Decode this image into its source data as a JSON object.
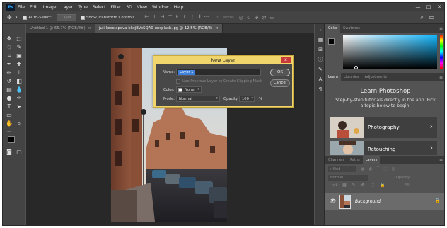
{
  "app": {
    "logo": "Ps"
  },
  "menu": [
    "File",
    "Edit",
    "Image",
    "Layer",
    "Type",
    "Select",
    "Filter",
    "3D",
    "View",
    "Window",
    "Help"
  ],
  "window_controls": {
    "minimize": "—",
    "maximize": "□",
    "close": "✕"
  },
  "options_bar": {
    "auto_select_label": "Auto-Select:",
    "auto_select_target": "Layer",
    "transform_controls_label": "Show Transform Controls",
    "mode_label": "3D Mode:"
  },
  "tabs": [
    {
      "label": "Untitled-1 @ 66.7% (RGB/8#)",
      "close": "×"
    },
    {
      "label": "juli-kosolapova-bkcjBVeSQA0-unsplash.jpg @ 12.5% (RGB/8)",
      "close": "×"
    }
  ],
  "dialog": {
    "title": "New Layer",
    "name_label": "Name:",
    "name_value": "Layer 1",
    "clipping_mask_label": "Use Previous Layer to Create Clipping Mask",
    "color_label": "Color:",
    "color_value": "None",
    "mode_label": "Mode:",
    "mode_value": "Normal",
    "opacity_label": "Opacity:",
    "opacity_value": "100",
    "opacity_unit": "%",
    "ok_label": "OK",
    "cancel_label": "Cancel",
    "close_glyph": "x"
  },
  "color_panel": {
    "tabs": [
      "Color",
      "Swatches"
    ]
  },
  "learn_panel": {
    "tabs": [
      "Learn",
      "Libraries",
      "Adjustments"
    ],
    "title": "Learn Photoshop",
    "subtitle": "Step-by-step tutorials directly in the app. Pick a topic below to begin.",
    "topics": [
      {
        "label": "Photography",
        "arrow": "›"
      },
      {
        "label": "Retouching",
        "arrow": "›"
      }
    ]
  },
  "layers_panel": {
    "tabs": [
      "Channels",
      "Paths",
      "Layers"
    ],
    "kind_placeholder": "Kind",
    "blend_mode": "Normal",
    "opacity_label": "Opacity:",
    "lock_label": "Lock:",
    "fill_label": "Fill:",
    "layer_name": "Background"
  },
  "colors": {
    "accent": "#31a8ff",
    "dialog_frame": "#efd56c",
    "close_button": "#c83a3a",
    "workspace": "#535353"
  }
}
